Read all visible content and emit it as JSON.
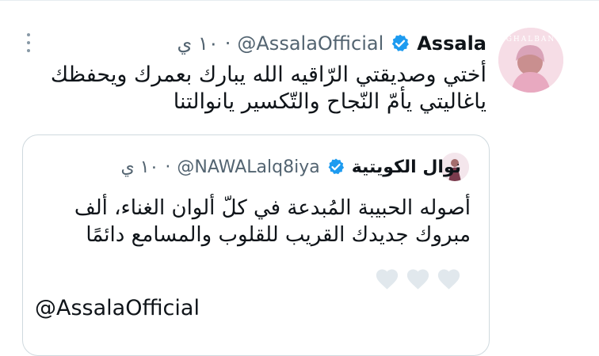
{
  "tweet": {
    "display_name": "Assala",
    "handle": "@AssalaOfficial",
    "separator": "·",
    "time": "١٠ ي",
    "text": "أختي وصديقتي الرّاقيه الله يبارك بعمرك ويحفظك ياغاليتي يأمّ النّجاح والتّكسير يانوالتنا",
    "avatar_brand": "GHALBAN",
    "avatar_colors": {
      "bg": "#f3d7e1",
      "accent": "#e8a9c0"
    }
  },
  "quote": {
    "display_name": "نوال الكويتية",
    "handle": "@NAWALalq8iya",
    "separator": "·",
    "time": "١٠ ي",
    "text": "أصوله الحبيبة المُبدعة في كلّ ألوان الغناء، ألف مبروك جديدك القريب للقلوب والمسامع دائمًا",
    "hearts_count": 3,
    "mention": "@AssalaOfficial"
  },
  "colors": {
    "verified": "#1d9bf0",
    "secondary_text": "#536471",
    "heart": "#e1e8ed",
    "border": "#cfd9de"
  },
  "icons": [
    "more-vertical-icon",
    "verified-badge-icon",
    "heart-icon"
  ]
}
